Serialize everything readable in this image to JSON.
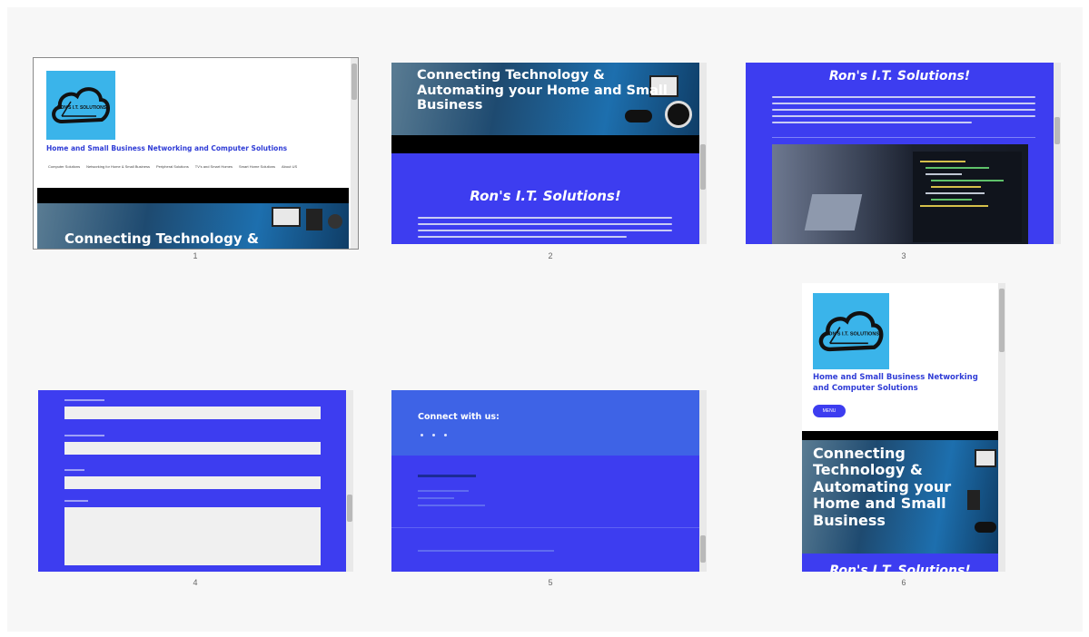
{
  "thumbnails": [
    {
      "number": "1",
      "logo_text": "RON'S I.T. SOLUTIONS",
      "tagline": "Home and Small Business Networking and Computer Solutions",
      "nav": [
        "Computer Solutions",
        "Networking for Home & Small Business",
        "Peripheral Solutions",
        "TV's and Smart Homes",
        "Smart Home Solutions",
        "About US"
      ],
      "hero": "Connecting Technology &"
    },
    {
      "number": "2",
      "hero": "Connecting Technology & Automating your Home and Small Business",
      "heading": "Ron's I.T. Solutions!"
    },
    {
      "number": "3",
      "heading": "Ron's I.T. Solutions!"
    },
    {
      "number": "4"
    },
    {
      "number": "5",
      "connect": "Connect with us:"
    },
    {
      "number": "6",
      "logo_text": "RON'S I.T. SOLUTIONS",
      "tagline": "Home and Small Business Networking and Computer Solutions",
      "menu": "MENU",
      "hero": "Connecting Technology & Automating your Home and Small Business",
      "heading": "Ron's I.T. Solutions!"
    }
  ],
  "colors": {
    "brand_blue": "#3d3df0",
    "logo_bg": "#3ab4ea",
    "footer_top": "#3e63e6",
    "tagline": "#2f3cd6"
  }
}
